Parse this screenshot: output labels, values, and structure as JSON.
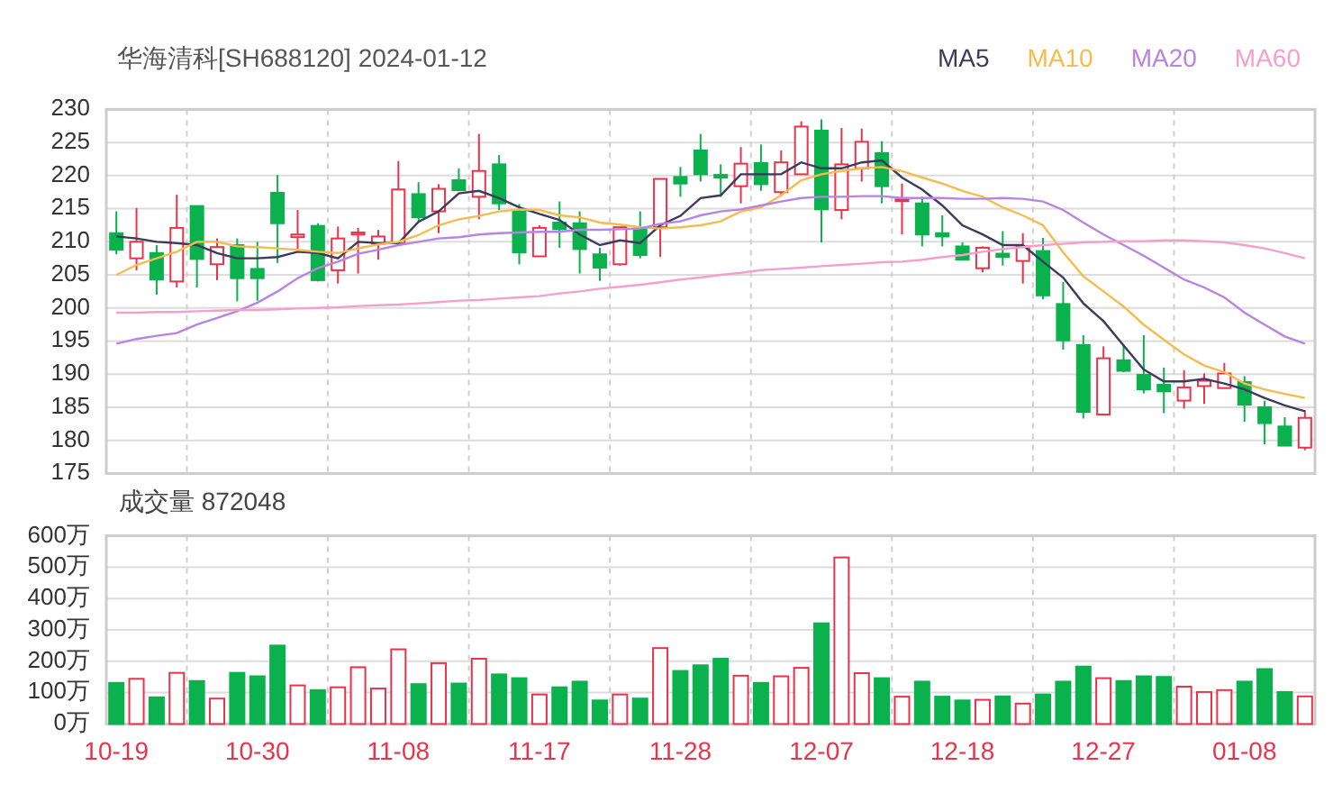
{
  "price_chart": {
    "title": "华海清科[SH688120] 2024-01-12",
    "chart_data": {
      "type": "candlestick",
      "grid": true,
      "categories": [
        null,
        null,
        null,
        null,
        null,
        null,
        null,
        null,
        null,
        null,
        null,
        null,
        null,
        null,
        null,
        null,
        null,
        null,
        null,
        null,
        null,
        null,
        null,
        null,
        null,
        null,
        null,
        null,
        null,
        null,
        null,
        null,
        null,
        null,
        null,
        null,
        null,
        null,
        null,
        null,
        null,
        null,
        null,
        null,
        null,
        null,
        null,
        null,
        null,
        null,
        null,
        null,
        null,
        null,
        null,
        null,
        null,
        null,
        null,
        null
      ],
      "ylim": [
        175,
        230
      ],
      "yticks": [
        175,
        180,
        185,
        190,
        195,
        200,
        205,
        210,
        215,
        220,
        225,
        230
      ],
      "ohlc": [
        [
          211.3,
          214.6,
          208.1,
          208.8
        ],
        [
          207.5,
          215.1,
          205.7,
          210.0
        ],
        [
          208.3,
          209.5,
          202.0,
          204.3
        ],
        [
          204.0,
          217.1,
          203.1,
          212.1
        ],
        [
          215.4,
          215.4,
          203.1,
          207.4
        ],
        [
          206.6,
          210.5,
          204.2,
          209.2
        ],
        [
          209.5,
          210.5,
          201.0,
          204.5
        ],
        [
          205.9,
          210.0,
          201.1,
          204.5
        ],
        [
          217.4,
          220.1,
          206.8,
          212.8
        ],
        [
          210.7,
          214.8,
          208.4,
          211.1
        ],
        [
          212.4,
          212.8,
          204.0,
          204.2
        ],
        [
          205.7,
          212.3,
          203.7,
          210.5
        ],
        [
          211.1,
          212.1,
          205.2,
          211.4
        ],
        [
          209.7,
          211.8,
          207.3,
          210.8
        ],
        [
          209.8,
          222.2,
          209.8,
          217.9
        ],
        [
          217.2,
          219.0,
          213.1,
          213.7
        ],
        [
          214.6,
          218.7,
          211.3,
          218.0
        ],
        [
          219.3,
          221.1,
          217.7,
          217.8
        ],
        [
          216.8,
          226.3,
          213.4,
          220.7
        ],
        [
          221.7,
          223.1,
          214.8,
          215.8
        ],
        [
          214.6,
          215.7,
          206.6,
          208.4
        ],
        [
          207.8,
          212.5,
          207.8,
          212.1
        ],
        [
          212.9,
          216.1,
          209.1,
          211.9
        ],
        [
          212.8,
          214.6,
          205.2,
          208.9
        ],
        [
          208.1,
          209.1,
          204.1,
          206.1
        ],
        [
          206.6,
          212.2,
          206.4,
          212.2
        ],
        [
          212.0,
          214.6,
          207.5,
          208.0
        ],
        [
          212.2,
          219.5,
          207.7,
          219.5
        ],
        [
          219.8,
          221.3,
          216.8,
          218.8
        ],
        [
          223.8,
          226.3,
          219.1,
          220.2
        ],
        [
          220.1,
          221.7,
          216.8,
          219.7
        ],
        [
          218.4,
          224.3,
          215.8,
          221.8
        ],
        [
          221.9,
          224.7,
          217.7,
          218.7
        ],
        [
          217.5,
          223.8,
          216.9,
          222.0
        ],
        [
          220.2,
          228.2,
          220.2,
          227.4
        ],
        [
          226.8,
          228.5,
          209.9,
          214.9
        ],
        [
          214.8,
          227.2,
          213.4,
          221.7
        ],
        [
          221.1,
          227.1,
          219.1,
          225.1
        ],
        [
          223.4,
          225.2,
          215.8,
          218.4
        ],
        [
          216.2,
          218.8,
          211.1,
          216.4
        ],
        [
          215.8,
          216.8,
          209.3,
          211.1
        ],
        [
          211.3,
          214.0,
          209.3,
          210.8
        ],
        [
          209.3,
          209.9,
          207.2,
          207.3
        ],
        [
          206.0,
          209.3,
          205.4,
          209.1
        ],
        [
          208.2,
          211.6,
          206.4,
          207.7
        ],
        [
          207.1,
          211.3,
          203.7,
          209.3
        ],
        [
          208.6,
          210.6,
          201.3,
          201.9
        ],
        [
          200.6,
          203.9,
          193.7,
          195.1
        ],
        [
          194.4,
          195.9,
          183.3,
          184.3
        ],
        [
          183.9,
          194.2,
          183.9,
          192.4
        ],
        [
          192.1,
          194.5,
          190.3,
          190.5
        ],
        [
          189.9,
          195.9,
          187.1,
          187.7
        ],
        [
          188.4,
          191.0,
          184.1,
          187.4
        ],
        [
          186.0,
          190.6,
          184.8,
          188.0
        ],
        [
          188.2,
          190.1,
          185.5,
          189.0
        ],
        [
          187.9,
          191.7,
          187.9,
          190.1
        ],
        [
          188.8,
          189.7,
          182.8,
          185.4
        ],
        [
          185.0,
          186.0,
          179.4,
          182.6
        ],
        [
          182.1,
          183.5,
          179.2,
          179.2
        ],
        [
          178.9,
          184.6,
          178.5,
          183.4
        ]
      ]
    },
    "averages": {
      "chart_data": {
        "type": "line",
        "ylim": [
          175,
          230
        ],
        "series": [
          {
            "name": "MA5",
            "color": "#3d3a5c",
            "values": [
              210.8,
              210.5,
              210.0,
              209.8,
              209.5,
              208.3,
              207.5,
              207.5,
              207.7,
              208.5,
              208.3,
              207.5,
              210.0,
              209.8,
              209.8,
              213.0,
              214.6,
              217.3,
              217.7,
              216.6,
              215.2,
              214.2,
              213.3,
              211.1,
              209.5,
              210.2,
              209.8,
              212.5,
              213.9,
              216.6,
              217.0,
              220.2,
              220.2,
              220.2,
              222.0,
              221.1,
              221.1,
              222.0,
              222.3,
              219.7,
              217.9,
              215.5,
              212.5,
              211.1,
              209.5,
              209.5,
              207.0,
              204.6,
              200.7,
              198.0,
              194.3,
              190.7,
              188.9,
              188.9,
              189.3,
              188.6,
              187.7,
              186.4,
              185.3,
              184.4
            ]
          },
          {
            "name": "MA10",
            "color": "#f7bb4d",
            "values": [
              205.0,
              206.5,
              207.5,
              208.5,
              210.0,
              210.0,
              209.3,
              209.2,
              209.0,
              208.8,
              208.5,
              208.3,
              209.0,
              209.6,
              210.0,
              211.0,
              212.5,
              213.4,
              213.9,
              214.6,
              214.9,
              214.8,
              214.0,
              213.7,
              212.9,
              212.6,
              212.2,
              212.0,
              212.2,
              212.5,
              213.1,
              214.6,
              215.2,
              217.0,
              219.3,
              220.2,
              220.7,
              221.1,
              221.3,
              220.7,
              219.7,
              218.8,
              217.7,
              216.8,
              215.2,
              214.0,
              212.5,
              208.4,
              204.8,
              202.5,
              200.2,
              197.5,
              195.2,
              193.0,
              191.3,
              190.3,
              188.6,
              187.7,
              187.0,
              186.4
            ]
          },
          {
            "name": "MA20",
            "color": "#b784e3",
            "values": [
              194.6,
              195.3,
              195.8,
              196.2,
              197.5,
              198.5,
              199.5,
              200.8,
              202.5,
              204.5,
              206.0,
              207.0,
              208.2,
              208.8,
              209.5,
              210.0,
              210.5,
              210.7,
              211.1,
              211.3,
              211.4,
              211.5,
              211.5,
              211.8,
              211.8,
              211.9,
              212.0,
              212.7,
              213.1,
              214.0,
              214.6,
              214.9,
              215.5,
              216.1,
              216.6,
              216.8,
              216.8,
              216.9,
              216.9,
              216.6,
              216.6,
              216.6,
              216.5,
              216.5,
              216.6,
              216.5,
              216.1,
              214.8,
              212.9,
              211.1,
              209.5,
              207.9,
              206.1,
              204.3,
              203.1,
              201.6,
              199.3,
              197.5,
              195.7,
              194.6
            ]
          },
          {
            "name": "MA60",
            "color": "#f59fcb",
            "values": [
              199.3,
              199.3,
              199.4,
              199.4,
              199.5,
              199.6,
              199.7,
              199.7,
              199.8,
              199.9,
              200.0,
              200.1,
              200.3,
              200.4,
              200.5,
              200.7,
              200.9,
              201.1,
              201.2,
              201.4,
              201.6,
              201.8,
              202.2,
              202.5,
              202.9,
              203.2,
              203.5,
              203.9,
              204.3,
              204.6,
              205.0,
              205.3,
              205.7,
              205.9,
              206.1,
              206.3,
              206.5,
              206.7,
              206.9,
              207.0,
              207.3,
              207.7,
              208.0,
              208.5,
              208.9,
              209.2,
              209.5,
              209.7,
              209.9,
              210.0,
              210.1,
              210.1,
              210.2,
              210.2,
              210.1,
              209.9,
              209.5,
              209.0,
              208.3,
              207.5
            ]
          }
        ]
      }
    }
  },
  "volume_chart": {
    "title": "成交量 872048",
    "chart_data": {
      "type": "bar",
      "grid": true,
      "categories": [
        "10-19",
        null,
        null,
        null,
        null,
        null,
        null,
        "10-30",
        null,
        null,
        null,
        null,
        null,
        null,
        "11-08",
        null,
        null,
        null,
        null,
        null,
        null,
        "11-17",
        null,
        null,
        null,
        null,
        null,
        null,
        "11-28",
        null,
        null,
        null,
        null,
        null,
        null,
        "12-07",
        null,
        null,
        null,
        null,
        null,
        null,
        "12-18",
        null,
        null,
        null,
        null,
        null,
        null,
        "12-27",
        null,
        null,
        null,
        null,
        null,
        null,
        "01-08",
        null,
        null,
        null
      ],
      "ylim": [
        0,
        600
      ],
      "yticks": [
        {
          "value": 0,
          "label": "0万"
        },
        {
          "value": 100,
          "label": "100万"
        },
        {
          "value": 200,
          "label": "200万"
        },
        {
          "value": 300,
          "label": "300万"
        },
        {
          "value": 400,
          "label": "400万"
        },
        {
          "value": 500,
          "label": "500万"
        },
        {
          "value": 600,
          "label": "600万"
        }
      ],
      "values": [
        131,
        144,
        85,
        163,
        137,
        81,
        163,
        152,
        250,
        123,
        108,
        117,
        181,
        113,
        238,
        127,
        194,
        129,
        208,
        158,
        146,
        94,
        117,
        135,
        75,
        94,
        81,
        242,
        169,
        187,
        208,
        154,
        131,
        152,
        179,
        321,
        531,
        162,
        146,
        87,
        135,
        87,
        75,
        77,
        88,
        65,
        94,
        135,
        183,
        146,
        137,
        152,
        150,
        119,
        102,
        108,
        135,
        175,
        102,
        88
      ]
    }
  }
}
